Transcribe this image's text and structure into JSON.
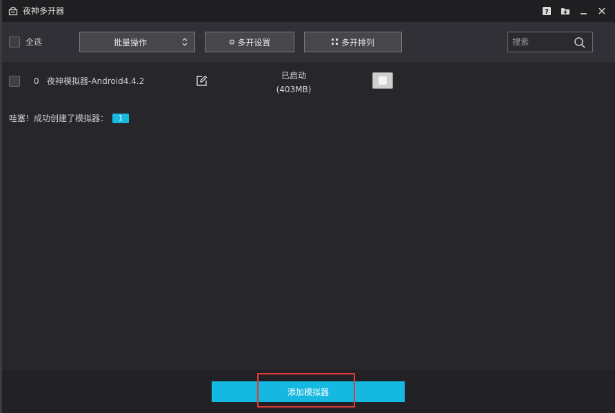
{
  "window": {
    "title": "夜神多开器",
    "icons": [
      "app-icon",
      "help-icon",
      "import-icon",
      "minimize-icon",
      "close-icon"
    ]
  },
  "toolbar": {
    "select_all_label": "全选",
    "batch_label": "批量操作",
    "settings_label": "多开设置",
    "arrange_label": "多开排列",
    "search_placeholder": "搜索"
  },
  "emulators": [
    {
      "index": "0",
      "name": "夜神模拟器-Android4.4.2",
      "status": "已启动",
      "memory": "(403MB)",
      "running": true
    }
  ],
  "notice": {
    "text": "哇塞！成功创建了模拟器：",
    "count": "1"
  },
  "footer": {
    "add_label": "添加模拟器"
  },
  "colors": {
    "accent": "#14b8e0",
    "highlight": "#e23a3a",
    "background": "#28282c"
  }
}
